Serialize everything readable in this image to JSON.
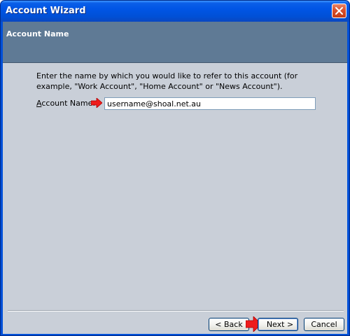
{
  "window": {
    "title": "Account Wizard"
  },
  "banner": {
    "title": "Account Name"
  },
  "form": {
    "instructions": "Enter the name by which you would like to refer to this account (for example, \"Work Account\", \"Home Account\" or \"News Account\").",
    "label_hotkey": "A",
    "label_rest": "ccount Name:",
    "account_name_value": "username@shoal.net.au"
  },
  "buttons": {
    "back": "< Back",
    "next": "Next >",
    "cancel": "Cancel"
  },
  "icons": {
    "close": "close-icon",
    "pointer_arrow": "right-arrow-icon"
  },
  "colors": {
    "titlebar": "#0055e5",
    "banner": "#5f7a95",
    "client_bg": "#c9cfd8",
    "arrow": "#ee1c1c",
    "close_button": "#d9502c"
  }
}
